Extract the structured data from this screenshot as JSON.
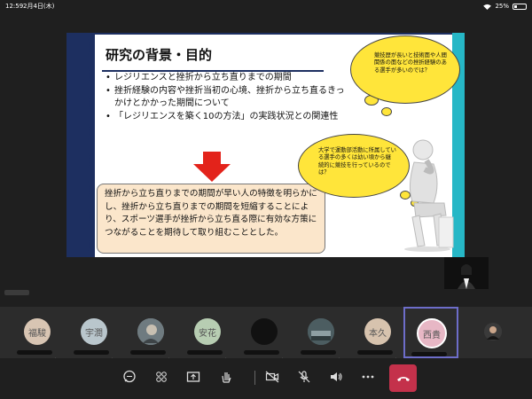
{
  "status_bar": {
    "time": "12:59",
    "date": "2月4日(木)",
    "battery": "25%",
    "battery_level": 0.25
  },
  "slide": {
    "title": "研究の背景・目的",
    "bullets": [
      "レジリエンスと挫折から立ち直りまでの期間",
      "挫折経験の内容や挫折当初の心境、挫折から立ち直るきっかけとかかった期間について",
      "「レジリエンスを築く10の方法」の実践状況との関連性"
    ],
    "result_text": "挫折から立ち直りまでの期間が早い人の特徴を明らかにし、挫折から立ち直りまでの期間を短縮することにより、スポーツ選手が挫折から立ち直る際に有効な方策につながることを期待して取り組むこととした。",
    "cloud1_text": "競技歴が長いと技術面や人間関係の面などの挫折経験のある選手が多いのでは？",
    "cloud2_text": "大学で運動部活動に所属している選手の多くは幼い頃から継続的に競技を行っているのでは？"
  },
  "participants": [
    {
      "initials": "福駿",
      "color": "#d8c5b3"
    },
    {
      "initials": "宇潤",
      "color": "#b9c6cc"
    },
    {
      "initials": "",
      "color": "#6f7b80"
    },
    {
      "initials": "安花",
      "color": "#b7cdb2"
    },
    {
      "initials": "",
      "color": "#111111"
    },
    {
      "initials": "",
      "color": "#4c5d61"
    },
    {
      "initials": "本久",
      "color": "#d7c3ae"
    },
    {
      "initials": "西貴",
      "color": "#e7b7c5"
    },
    {
      "initials": "",
      "color": "#3a3a3a"
    }
  ],
  "toolbar": {
    "icons": [
      "chat-icon",
      "participants-icon",
      "share-screen-icon",
      "raise-hand-icon",
      "camera-off-icon",
      "mic-off-icon",
      "speaker-icon",
      "more-icon",
      "leave-call-icon"
    ],
    "leave_color": "#c4314b"
  },
  "colors": {
    "slide_band": "#1d2f60",
    "slide_accent": "#26b7c6",
    "cloud": "#ffe53a",
    "result_box": "#fbe6cb",
    "active_tile_border": "#6d6dc9"
  }
}
